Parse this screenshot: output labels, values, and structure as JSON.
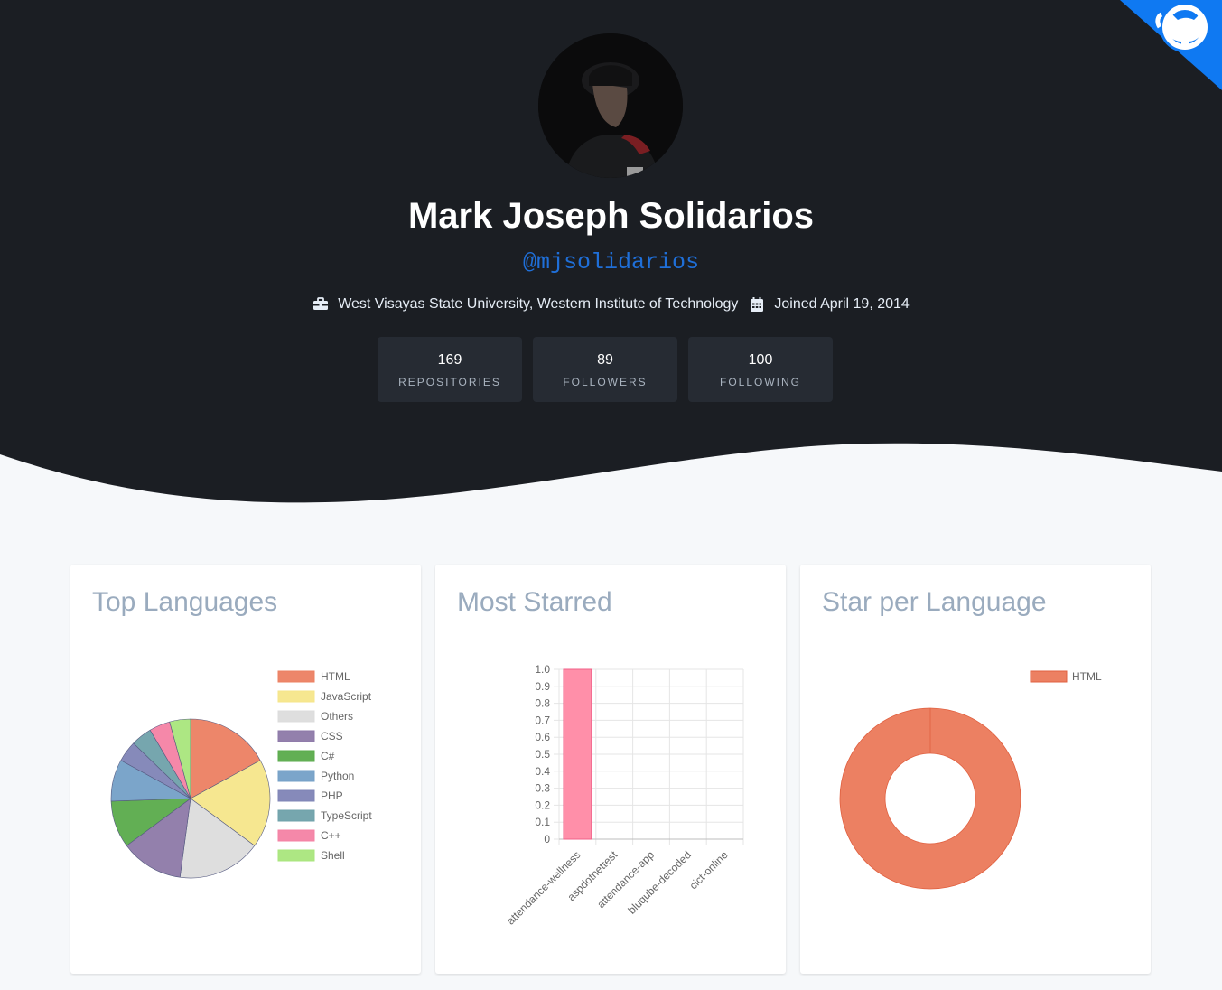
{
  "profile": {
    "name": "Mark Joseph Solidarios",
    "handle": "@mjsolidarios",
    "organization": "West Visayas State University, Western Institute of Technology",
    "joined": "Joined April 19, 2014"
  },
  "stats": [
    {
      "value": "169",
      "label": "Repositories"
    },
    {
      "value": "89",
      "label": "Followers"
    },
    {
      "value": "100",
      "label": "Following"
    }
  ],
  "cards": {
    "top_languages": {
      "title": "Top Languages"
    },
    "most_starred": {
      "title": "Most Starred"
    },
    "star_per_language": {
      "title": "Star per Language"
    }
  },
  "icons": {
    "briefcase": "briefcase-icon",
    "calendar": "calendar-icon",
    "corner": "octocat-icon"
  },
  "colors": {
    "hero_bg": "#1b1e23",
    "accent_blue": "#1f6fd8",
    "corner_blue": "#0f79f2"
  },
  "chart_data": [
    {
      "type": "pie",
      "categories": [
        "HTML",
        "JavaScript",
        "Others",
        "CSS",
        "C#",
        "Python",
        "PHP",
        "TypeScript",
        "C++",
        "Shell"
      ],
      "values": [
        16,
        17,
        16,
        12,
        9,
        8,
        4,
        4,
        4,
        4
      ],
      "colors": [
        "#ec8062",
        "#f5e68a",
        "#dcdcdc",
        "#8d79a8",
        "#5aab4b",
        "#74a0c7",
        "#7f84b6",
        "#6fa1aa",
        "#f482a4",
        "#a9e67c"
      ],
      "legend": "right"
    },
    {
      "type": "bar",
      "categories": [
        "attendance-wellness",
        "aspdotnettest",
        "attendance-app",
        "bluqube-decoded",
        "cict-online"
      ],
      "values": [
        1,
        0,
        0,
        0,
        0
      ],
      "ylim": [
        0,
        1
      ],
      "yticks": [
        "0",
        "0.1",
        "0.2",
        "0.3",
        "0.4",
        "0.5",
        "0.6",
        "0.7",
        "0.8",
        "0.9",
        "1.0"
      ],
      "color": "#ff8fa9",
      "grid": true
    },
    {
      "type": "doughnut",
      "categories": [
        "HTML"
      ],
      "values": [
        1
      ],
      "colors": [
        "#ec8062"
      ],
      "legend": "top-right"
    }
  ]
}
